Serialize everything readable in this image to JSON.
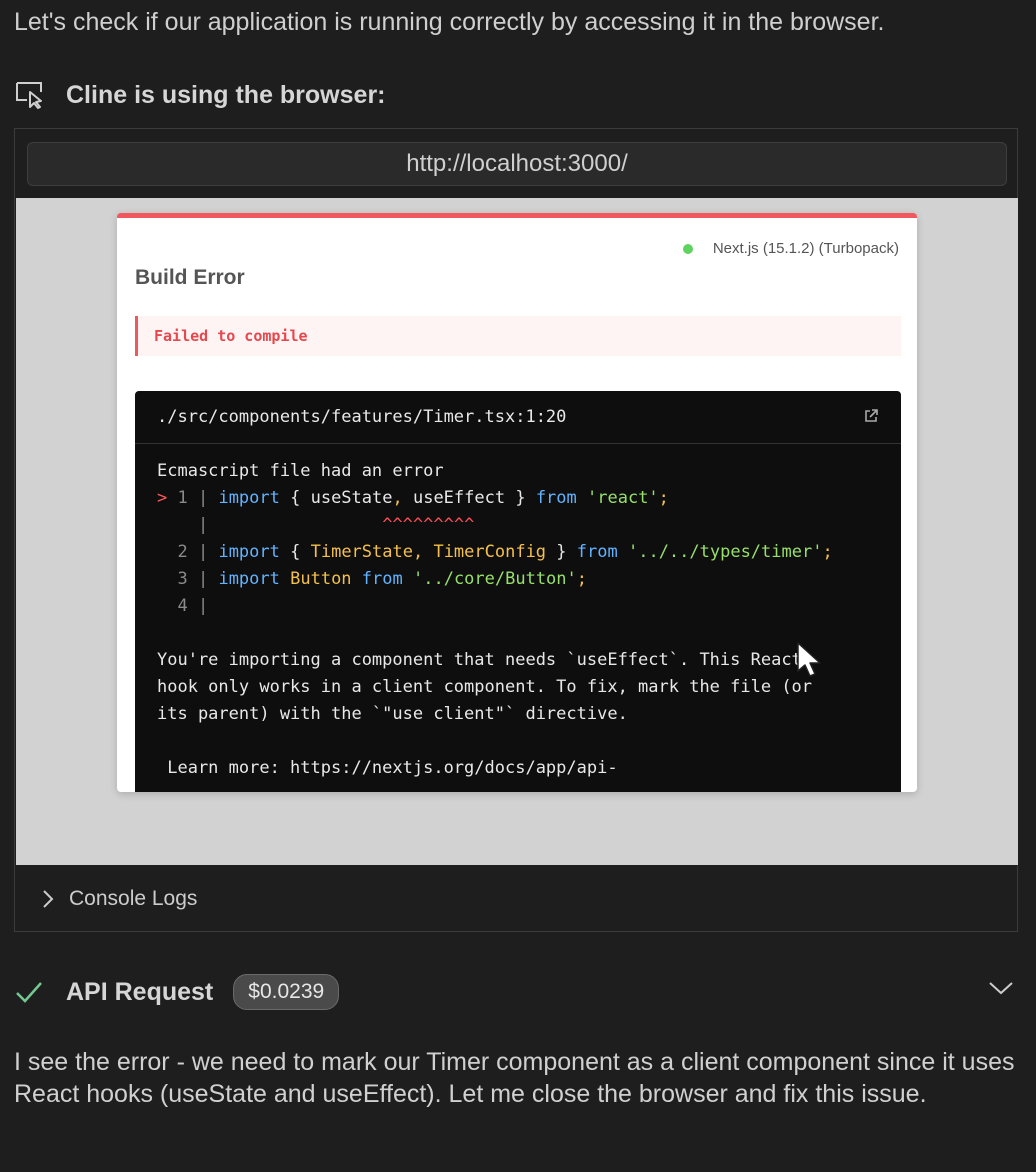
{
  "intro_text": "Let's check if our application is running correctly by accessing it in the browser.",
  "browser_header": {
    "title": "Cline is using the browser:",
    "icon": "browser-cursor-icon"
  },
  "browser": {
    "url": "http://localhost:3000/",
    "page": {
      "next_version": "Next.js (15.1.2) (Turbopack)",
      "status_color": "#5fd35f",
      "error_title": "Build Error",
      "fail_message": "Failed to compile",
      "accent_color": "#f0585d",
      "code": {
        "file_path": "./src/components/features/Timer.tsx:1:20",
        "heading": "Ecmascript file had an error",
        "line1_number": "1",
        "line1": {
          "kw_import": "import",
          "lb": "{ useState",
          "comma": ",",
          "ident": " useEffect }",
          "kw_from": "from",
          "module": "'react'",
          "semi": ";"
        },
        "squiggle": "^^^^^^^^^",
        "line2_number": "2",
        "line2": {
          "kw_import": "import",
          "lb": "{ ",
          "t1": "TimerState",
          "comma": ", ",
          "t2": "TimerConfig",
          "rb": " }",
          "kw_from": "from",
          "module": "'../../types/timer'",
          "semi": ";"
        },
        "line3_number": "3",
        "line3": {
          "kw_import": "import",
          "ident": "Button",
          "kw_from": "from",
          "module": "'../core/Button'",
          "semi": ";"
        },
        "line4_number": "4",
        "message_lines": [
          "You're importing a component that needs `useEffect`. This React",
          "hook only works in a client component. To fix, mark the file (or",
          "its parent) with the `\"use client\"` directive."
        ],
        "learn_more": " Learn more: https://nextjs.org/docs/app/api-"
      }
    },
    "console_logs_label": "Console Logs"
  },
  "api_request": {
    "title": "API Request",
    "cost": "$0.0239",
    "status": "success"
  },
  "response_text": "I see the error - we need to mark our Timer component as a client component since it uses React hooks (useState and useEffect). Let me close the browser and fix this issue."
}
